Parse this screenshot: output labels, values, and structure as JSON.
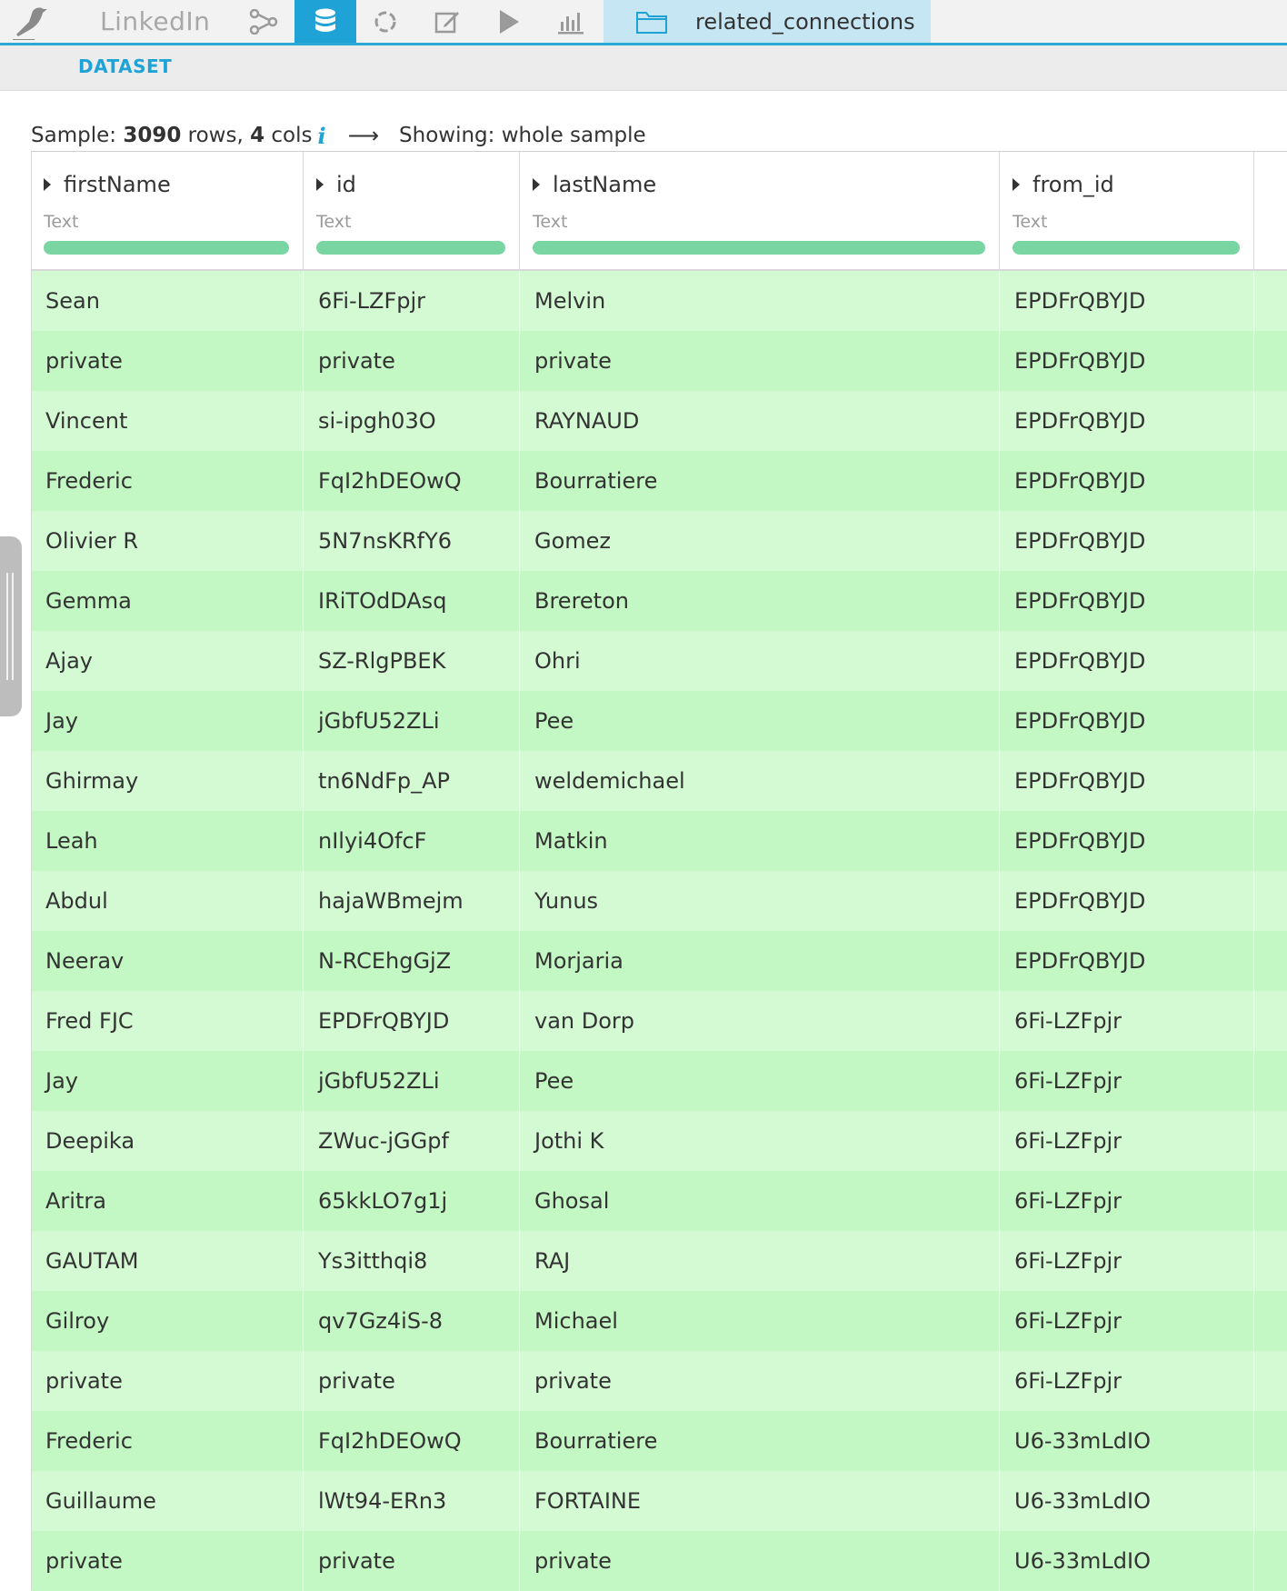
{
  "nav": {
    "project_name": "LinkedIn",
    "dataset_tab_label": "related_connections"
  },
  "subnav": {
    "dataset_label": "DATASET"
  },
  "sample": {
    "prefix": "Sample: ",
    "rows": "3090",
    "rows_suffix": " rows, ",
    "cols": "4",
    "cols_suffix": " cols",
    "info": "i",
    "arrow": "⟶",
    "showing": "Showing: whole sample"
  },
  "columns": [
    {
      "name": "firstName",
      "type": "Text"
    },
    {
      "name": "id",
      "type": "Text"
    },
    {
      "name": "lastName",
      "type": "Text"
    },
    {
      "name": "from_id",
      "type": "Text"
    }
  ],
  "rows": [
    [
      "Sean",
      "6Fi-LZFpjr",
      "Melvin",
      "EPDFrQBYJD"
    ],
    [
      "private",
      "private",
      "private",
      "EPDFrQBYJD"
    ],
    [
      "Vincent",
      "si-ipgh03O",
      "RAYNAUD",
      "EPDFrQBYJD"
    ],
    [
      "Frederic",
      "FqI2hDEOwQ",
      "Bourratiere",
      "EPDFrQBYJD"
    ],
    [
      "Olivier R",
      "5N7nsKRfY6",
      "Gomez",
      "EPDFrQBYJD"
    ],
    [
      "Gemma",
      "IRiTOdDAsq",
      "Brereton",
      "EPDFrQBYJD"
    ],
    [
      "Ajay",
      "SZ-RlgPBEK",
      "Ohri",
      "EPDFrQBYJD"
    ],
    [
      "Jay",
      "jGbfU52ZLi",
      "Pee",
      "EPDFrQBYJD"
    ],
    [
      "Ghirmay",
      "tn6NdFp_AP",
      "weldemichael",
      "EPDFrQBYJD"
    ],
    [
      "Leah",
      "nIlyi4OfcF",
      "Matkin",
      "EPDFrQBYJD"
    ],
    [
      "Abdul",
      "hajaWBmejm",
      "Yunus",
      "EPDFrQBYJD"
    ],
    [
      "Neerav",
      "N-RCEhgGjZ",
      "Morjaria",
      "EPDFrQBYJD"
    ],
    [
      "Fred FJC",
      "EPDFrQBYJD",
      "van Dorp",
      "6Fi-LZFpjr"
    ],
    [
      "Jay",
      "jGbfU52ZLi",
      "Pee",
      "6Fi-LZFpjr"
    ],
    [
      "Deepika",
      "ZWuc-jGGpf",
      "Jothi K",
      "6Fi-LZFpjr"
    ],
    [
      "Aritra",
      "65kkLO7g1j",
      "Ghosal",
      "6Fi-LZFpjr"
    ],
    [
      "GAUTAM",
      "Ys3itthqi8",
      "RAJ",
      "6Fi-LZFpjr"
    ],
    [
      "Gilroy",
      "qv7Gz4iS-8",
      "Michael",
      "6Fi-LZFpjr"
    ],
    [
      "private",
      "private",
      "private",
      "6Fi-LZFpjr"
    ],
    [
      "Frederic",
      "FqI2hDEOwQ",
      "Bourratiere",
      "U6-33mLdIO"
    ],
    [
      "Guillaume",
      "lWt94-ERn3",
      "FORTAINE",
      "U6-33mLdIO"
    ],
    [
      "private",
      "private",
      "private",
      "U6-33mLdIO"
    ]
  ],
  "colors": {
    "accent": "#1fa3d6",
    "row_light": "#d4fad4",
    "row_dark": "#c3f7c3",
    "quality_bar": "#79d5a2"
  }
}
